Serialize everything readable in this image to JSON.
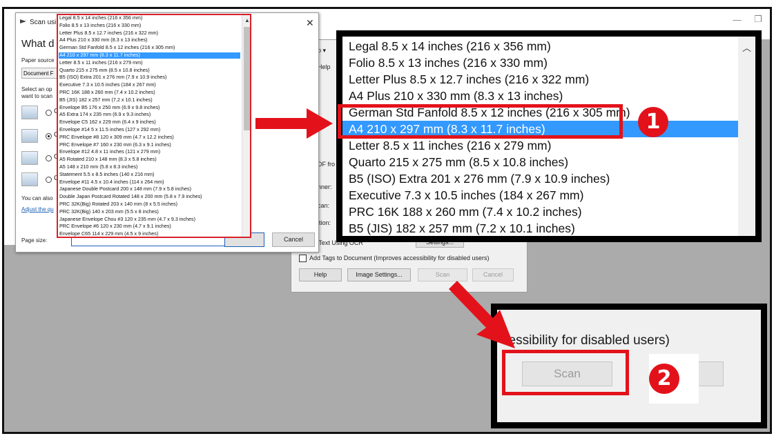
{
  "scan_dialog": {
    "title": "Scan usi",
    "heading": "What d",
    "paper_source_label": "Paper source",
    "paper_source_value": "Document F",
    "select_line1": "Select an op",
    "select_line2": "want to scan",
    "radio_fragments": [
      "C",
      "C",
      "C",
      "C"
    ],
    "footer_text": "You can also",
    "footer_link": "Adjust the qu",
    "page_size_label": "Page size:",
    "cancel_label": "Cancel"
  },
  "page_sizes": {
    "items": [
      "Legal 8.5 x 14 inches (216 x 356 mm)",
      "Folio 8.5 x 13 inches (216 x 330 mm)",
      "Letter Plus 8.5 x 12.7 inches (216 x 322 mm)",
      "A4 Plus 210 x 330 mm (8.3 x 13 inches)",
      "German Std Fanfold 8.5 x 12 inches (216 x 305 mm)",
      "A4 210 x 297 mm (8.3 x 11.7 inches)",
      "Letter 8.5 x 11 inches (216 x 279 mm)",
      "Quarto 215 x 275 mm (8.5 x 10.8 inches)",
      "B5 (ISO) Extra 201 x 276 mm (7.9 x 10.9 inches)",
      "Executive 7.3 x 10.5 inches (184 x 267 mm)",
      "PRC 16K 188 x 260 mm (7.4 x 10.2 inches)",
      "B5 (JIS) 182 x 257 mm (7.2 x 10.1 inches)",
      "Envelope B5 176 x 250 mm (6.9 x 9.8 inches)",
      "A5 Extra 174 x 235 mm (6.9 x 9.3 inches)",
      "Envelope C5 162 x 229 mm (6.4 x 9 inches)",
      "Envelope #14 5 x 11.5 inches (127 x 292 mm)",
      "PRC Envelope #8 120 x 309 mm (4.7 x 12.2 inches)",
      "PRC Envelope #7 160 x 230 mm (6.3 x 9.1 inches)",
      "Envelope #12 4.8 x 11 inches (121 x 279 mm)",
      "A5 Rotated 210 x 148 mm (8.3 x 5.8 inches)",
      "A5 148 x 210 mm (5.8 x 8.3 inches)",
      "Statement 5.5 x 8.5 inches (140 x 216 mm)",
      "Envelope #11 4.5 x 10.4 inches (114 x 264 mm)",
      "Japanese Double Postcard 200 x 148 mm (7.9 x 5.8 inches)",
      "Double Japan Postcard Rotated 148 x 200 mm (5.8 x 7.9 inches)",
      "PRC 32K(Big) Rotated 203 x 140 mm (8 x 5.5 inches)",
      "PRC 32K(Big) 140 x 203 mm (5.5 x 8 inches)",
      "Japanese Envelope Chou #3 120 x 235 mm (4.7 x 9.3 inches)",
      "PRC Envelope #6 120 x 230 mm (4.7 x 9.1 inches)",
      "Envelope C65 114 x 229 mm (4.5 x 9 inches)"
    ],
    "selected_index": 5,
    "accent_color": "#3399ff"
  },
  "acrobat_dialog": {
    "menu_fragment": "p ▾",
    "help_fragment": "Help",
    "pdf_from_fragment": "DF fro",
    "scanner_fragment": "nner:",
    "scan_fragment": "can:",
    "option_fragment": "ition:",
    "ocr_fragment": "cognize Text Using OCR",
    "settings_fragment": "Settings...",
    "add_tags_label": "Add Tags to Document (Improves accessibility for disabled users)",
    "help_button": "Help",
    "image_settings_button": "Image Settings...",
    "scan_button": "Scan",
    "cancel_button": "Cancel"
  },
  "zoom_scan": {
    "text": "cessibility for disabled users)",
    "scan_button": "Scan"
  },
  "badges": [
    "1",
    "2"
  ],
  "highlight_color": "#e3121a",
  "window_controls": [
    "—",
    "❐"
  ]
}
